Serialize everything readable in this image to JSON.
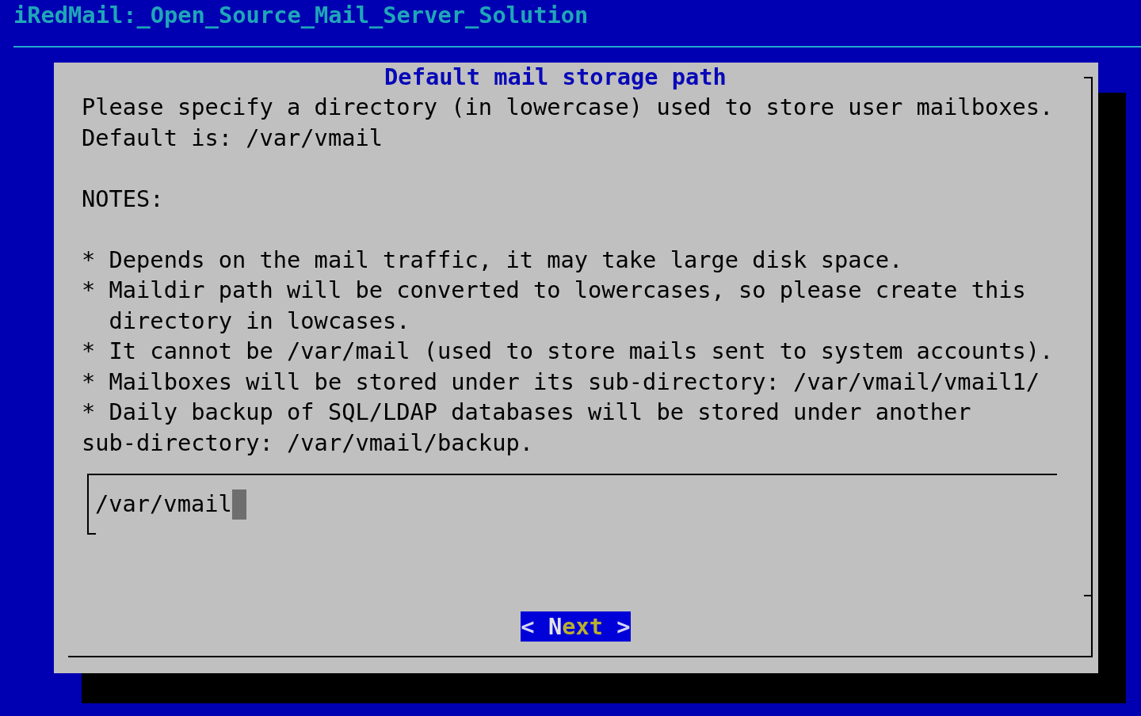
{
  "backtitle": "iRedMail:_Open_Source_Mail_Server_Solution",
  "dialog": {
    "title": "Default mail storage path",
    "intro": [
      "Please specify a directory (in lowercase) used to store user mailboxes.",
      "Default is: /var/vmail"
    ],
    "notes_heading": "NOTES:",
    "notes": [
      "* Depends on the mail traffic, it may take large disk space.",
      "* Maildir path will be converted to lowercases, so please create this\n  directory in lowcases.",
      "* It cannot be /var/mail (used to store mails sent to system accounts).",
      "* Mailboxes will be stored under its sub-directory: /var/vmail/vmail1/",
      "* Daily backup of SQL/LDAP databases will be stored under another\nsub-directory: /var/vmail/backup."
    ],
    "input": {
      "value": "/var/vmail",
      "focused": true
    },
    "button": {
      "left_mark": "<",
      "label": "Next",
      "right_mark": ">",
      "selected": true
    }
  }
}
